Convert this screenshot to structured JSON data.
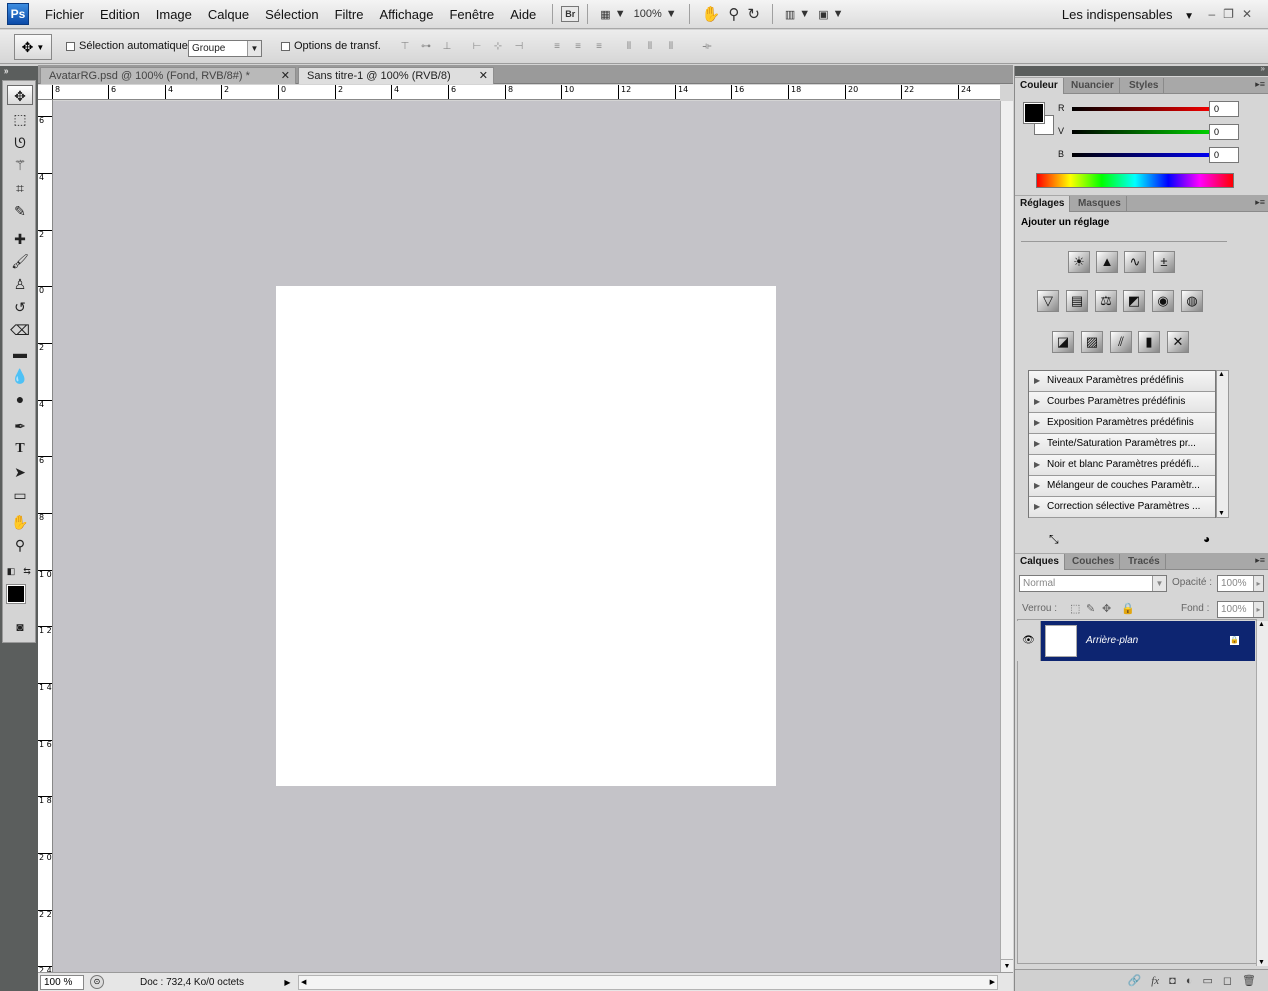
{
  "menubar": {
    "logo": "Ps",
    "items": [
      "Fichier",
      "Edition",
      "Image",
      "Calque",
      "Sélection",
      "Filtre",
      "Affichage",
      "Fenêtre",
      "Aide"
    ],
    "bridge": "Br",
    "zoom": "100%",
    "workspace": "Les indispensables"
  },
  "options": {
    "auto_select_label": "Sélection automatique :",
    "auto_select_value": "Groupe",
    "transform_label": "Options de transf."
  },
  "tabs": [
    {
      "label": "AvatarRG.psd @ 100% (Fond, RVB/8#) *",
      "close": "✕"
    },
    {
      "label": "Sans titre-1 @ 100% (RVB/8)",
      "close": "✕"
    }
  ],
  "rulers": {
    "h": [
      "8",
      "6",
      "4",
      "2",
      "0",
      "2",
      "4",
      "6",
      "8",
      "10",
      "12",
      "14",
      "16",
      "18",
      "20",
      "22",
      "24"
    ],
    "v": [
      "6",
      "4",
      "2",
      "0",
      "2",
      "4",
      "6",
      "8",
      "1 0",
      "1 2",
      "1 4",
      "1 6",
      "1 8",
      "2 0",
      "2 2",
      "2 4"
    ]
  },
  "status": {
    "zoom": "100 %",
    "doc": "Doc : 732,4 Ko/0 octets"
  },
  "color_panel": {
    "tabs": [
      "Couleur",
      "Nuancier",
      "Styles"
    ],
    "channels": [
      {
        "label": "R",
        "value": "0",
        "color": "#ff0000"
      },
      {
        "label": "V",
        "value": "0",
        "color": "#00d000"
      },
      {
        "label": "B",
        "value": "0",
        "color": "#0000ff"
      }
    ]
  },
  "adjustments": {
    "tabs": [
      "Réglages",
      "Masques"
    ],
    "title": "Ajouter un réglage",
    "presets": [
      "Niveaux Paramètres prédéfinis",
      "Courbes Paramètres prédéfinis",
      "Exposition Paramètres prédéfinis",
      "Teinte/Saturation Paramètres pr...",
      "Noir et blanc Paramètres prédéfi...",
      "Mélangeur de couches Paramètr...",
      "Correction sélective Paramètres ..."
    ]
  },
  "layers": {
    "tabs": [
      "Calques",
      "Couches",
      "Tracés"
    ],
    "blend": "Normal",
    "opacity_label": "Opacité :",
    "opacity": "100%",
    "lock_label": "Verrou :",
    "fill_label": "Fond :",
    "fill": "100%",
    "layer_name": "Arrière-plan",
    "footer_icons": [
      "🔗",
      "fx",
      "◘",
      "◐",
      "▭",
      "◻",
      "🗑"
    ]
  },
  "colors": {
    "accent": "#0d2571",
    "canvas_bg": "#c4c3c8"
  }
}
